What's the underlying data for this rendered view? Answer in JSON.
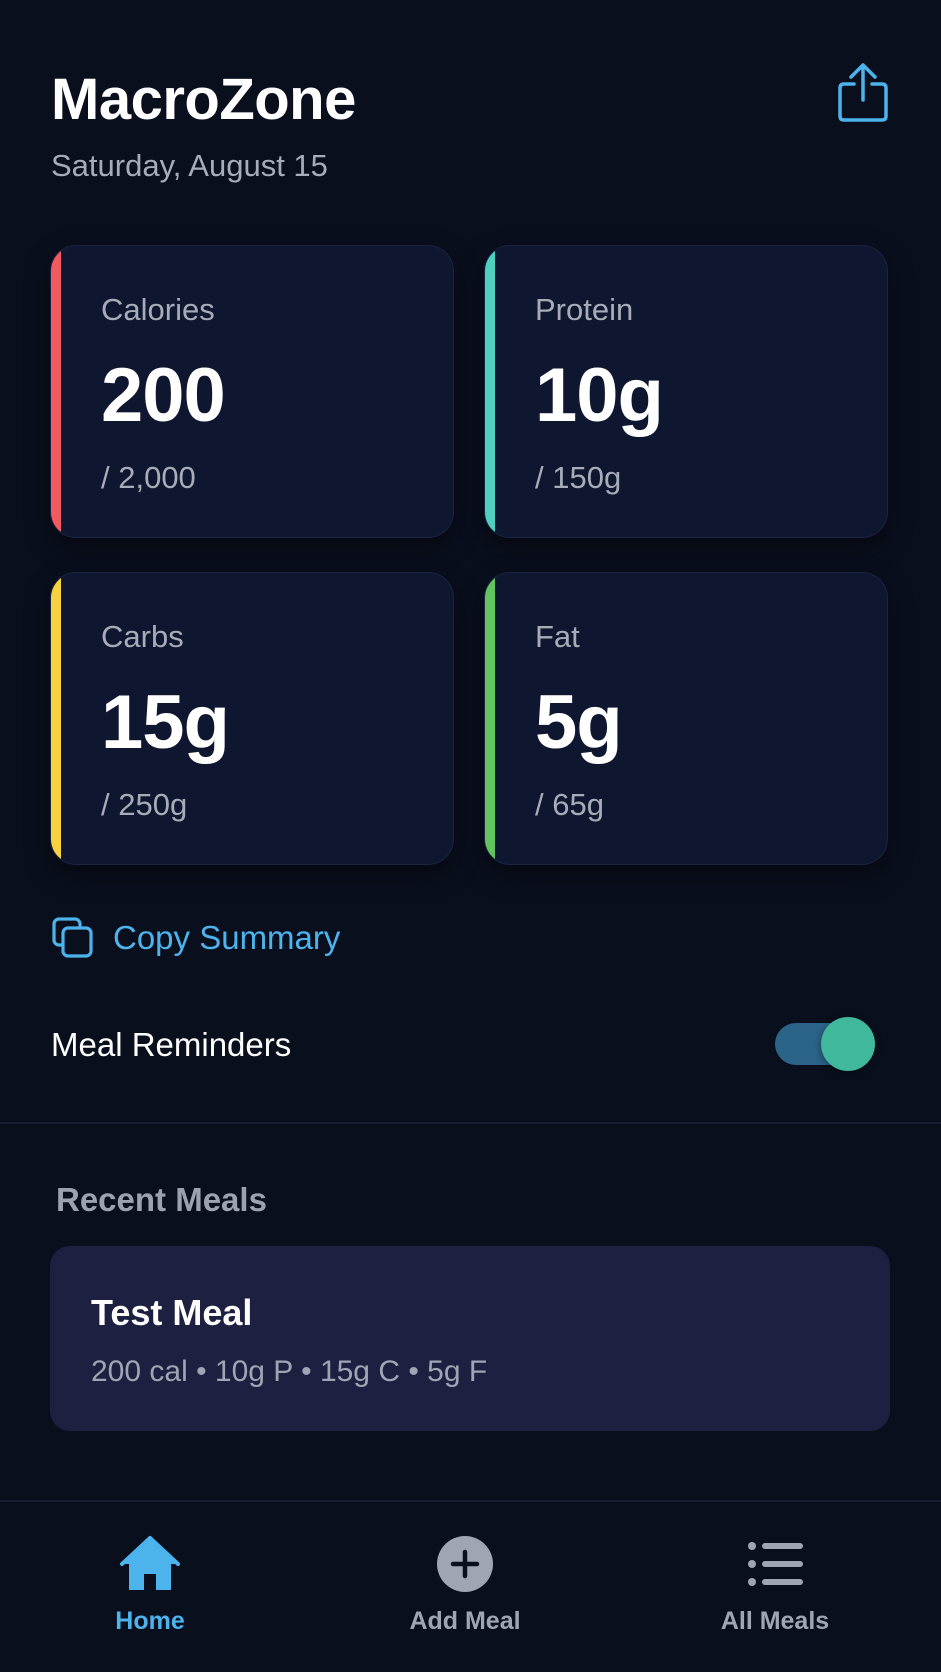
{
  "header": {
    "title": "MacroZone",
    "date": "Saturday, August 15",
    "share_icon": "share-icon"
  },
  "colors": {
    "background": "#0a0f1e",
    "card": "#0f1730",
    "calories_accent": "#f25a5f",
    "protein_accent": "#4fd0bf",
    "carbs_accent": "#f7d23c",
    "fat_accent": "#62c45c",
    "link": "#4db3ec",
    "toggle_on": "#3fb89b",
    "active_tab": "#4db3ec",
    "inactive_tab": "#a0a5b4"
  },
  "stats": {
    "calories": {
      "label": "Calories",
      "value": "200",
      "goal": "/ 2,000"
    },
    "protein": {
      "label": "Protein",
      "value": "10g",
      "goal": "/ 150g"
    },
    "carbs": {
      "label": "Carbs",
      "value": "15g",
      "goal": "/ 250g"
    },
    "fat": {
      "label": "Fat",
      "value": "5g",
      "goal": "/ 65g"
    }
  },
  "actions": {
    "copy_summary_label": "Copy Summary",
    "copy_icon": "copy-icon"
  },
  "settings": {
    "meal_reminders_label": "Meal Reminders",
    "meal_reminders_on": true
  },
  "recent_meals": {
    "title": "Recent Meals",
    "items": [
      {
        "name": "Test Meal",
        "macros": "200 cal • 10g P • 15g C • 5g F"
      }
    ]
  },
  "tabbar": {
    "tabs": [
      {
        "label": "Home",
        "icon": "home-icon",
        "active": true
      },
      {
        "label": "Add Meal",
        "icon": "plus-circle-icon",
        "active": false
      },
      {
        "label": "All Meals",
        "icon": "list-icon",
        "active": false
      }
    ]
  }
}
